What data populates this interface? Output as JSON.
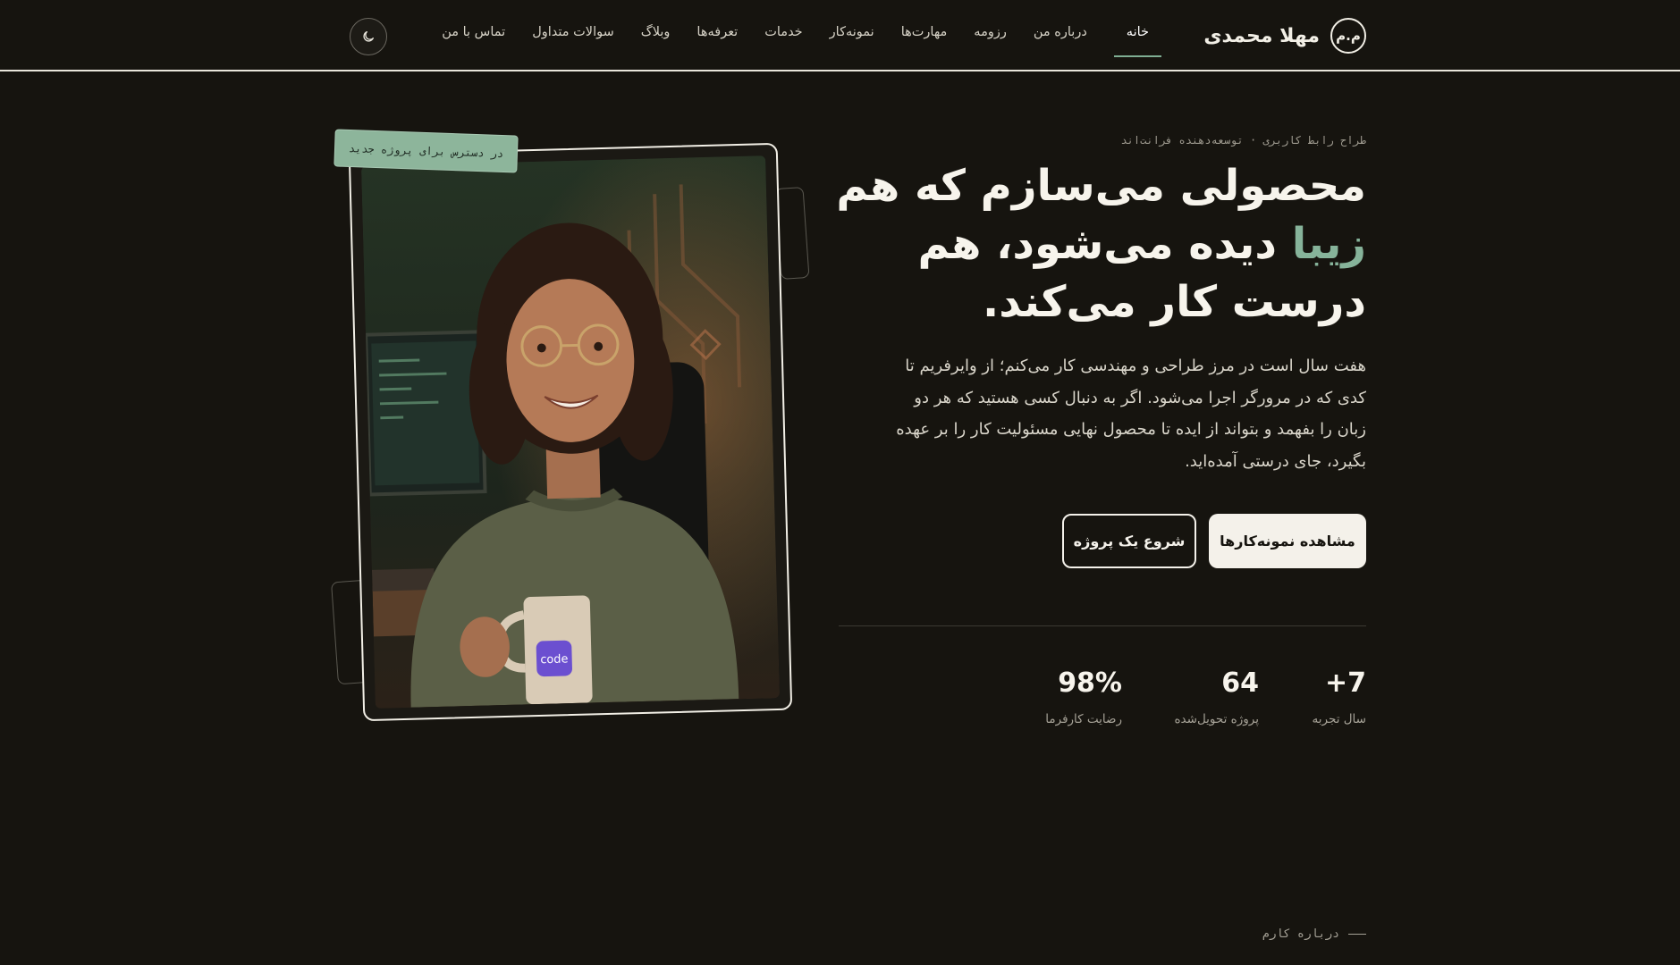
{
  "brand": {
    "mark": "م.م",
    "name": "مهلا محمدی"
  },
  "nav": {
    "items": [
      {
        "label": "خانه",
        "active": true
      },
      {
        "label": "درباره من",
        "active": false
      },
      {
        "label": "رزومه",
        "active": false
      },
      {
        "label": "مهارت‌ها",
        "active": false
      },
      {
        "label": "نمونه‌کار",
        "active": false
      },
      {
        "label": "خدمات",
        "active": false
      },
      {
        "label": "تعرفه‌ها",
        "active": false
      },
      {
        "label": "وبلاگ",
        "active": false
      },
      {
        "label": "سوالات متداول",
        "active": false
      },
      {
        "label": "تماس با من",
        "active": false
      }
    ],
    "theme_toggle_icon": "moon-icon"
  },
  "hero": {
    "eyebrow": "طراح رابط کاربری · توسعه‌دهنده فرانت‌اند",
    "headline_pre": "محصولی می‌سازم که هم ",
    "headline_accent": "زیبا",
    "headline_post": " دیده می‌شود، هم درست کار می‌کند.",
    "lead": "هفت سال است در مرز طراحی و مهندسی کار می‌کنم؛ از وایرفریم تا کدی که در مرورگر اجرا می‌شود. اگر به دنبال کسی هستید که هر دو زبان را بفهمد و بتواند از ایده تا محصول نهایی مسئولیت کار را بر عهده بگیرد، جای درستی آمده‌اید.",
    "primary_button": "مشاهده نمونه‌کارها",
    "secondary_button": "شروع یک پروژه",
    "accent_color": "#86b39a"
  },
  "stats": [
    {
      "value": "+7",
      "label": "سال تجربه"
    },
    {
      "value": "64",
      "label": "پروژه تحویل‌شده"
    },
    {
      "value": "98%",
      "label": "رضایت کارفرما"
    }
  ],
  "portrait": {
    "tag": "در دسترس برای پروژه جدید",
    "mug_text": "code"
  },
  "next_section": {
    "label": "درباره کارم"
  }
}
